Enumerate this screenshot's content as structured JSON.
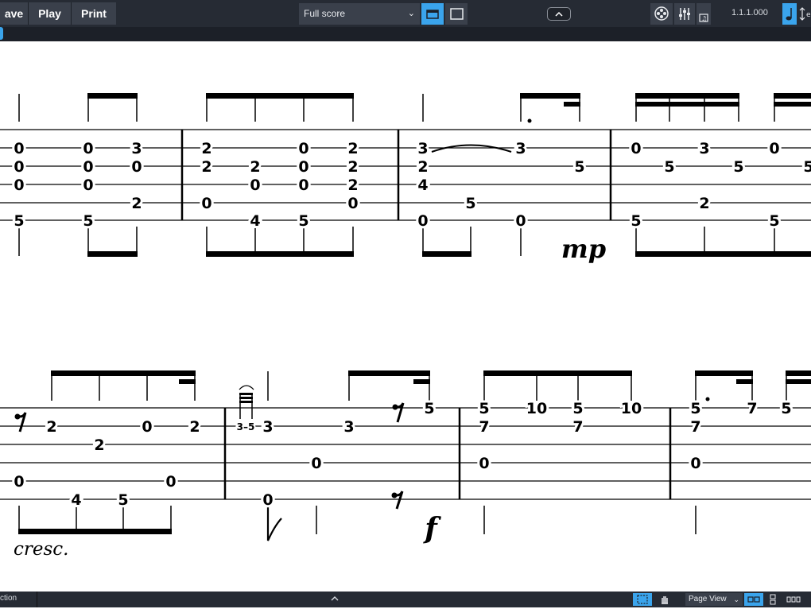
{
  "toolbar": {
    "save_label": "ave",
    "play_label": "Play",
    "print_label": "Print",
    "layout_select_value": "Full score",
    "rhythmic_position": "1.1.1.000",
    "accent_color": "#3aa4ec"
  },
  "statusbar": {
    "status_text": "ction",
    "view_select_value": "Page View"
  },
  "score": {
    "system1": {
      "fret_numbers": [
        {
          "bar": 1,
          "string": 1,
          "text": "0"
        },
        {
          "bar": 1,
          "string": 2,
          "text": "0"
        },
        {
          "bar": 1,
          "string": 3,
          "text": "0"
        },
        {
          "bar": 1,
          "string": 5,
          "text": "5"
        },
        {
          "bar": 1,
          "string": 1,
          "text": "0"
        },
        {
          "bar": 1,
          "string": 2,
          "text": "0"
        },
        {
          "bar": 1,
          "string": 3,
          "text": "0"
        },
        {
          "bar": 1,
          "string": 5,
          "text": "5"
        },
        {
          "bar": 1,
          "string": 1,
          "text": "3"
        },
        {
          "bar": 1,
          "string": 2,
          "text": "0"
        },
        {
          "bar": 1,
          "string": 4,
          "text": "2"
        },
        {
          "bar": 2,
          "string": 1,
          "text": "2"
        },
        {
          "bar": 2,
          "string": 2,
          "text": "2"
        },
        {
          "bar": 2,
          "string": 4,
          "text": "0"
        },
        {
          "bar": 2,
          "string": 2,
          "text": "2"
        },
        {
          "bar": 2,
          "string": 3,
          "text": "0"
        },
        {
          "bar": 2,
          "string": 5,
          "text": "4"
        },
        {
          "bar": 2,
          "string": 1,
          "text": "0"
        },
        {
          "bar": 2,
          "string": 2,
          "text": "0"
        },
        {
          "bar": 2,
          "string": 3,
          "text": "0"
        },
        {
          "bar": 2,
          "string": 5,
          "text": "5"
        },
        {
          "bar": 2,
          "string": 1,
          "text": "2"
        },
        {
          "bar": 2,
          "string": 2,
          "text": "2"
        },
        {
          "bar": 2,
          "string": 3,
          "text": "2"
        },
        {
          "bar": 2,
          "string": 4,
          "text": "0"
        },
        {
          "bar": 3,
          "string": 1,
          "text": "3"
        },
        {
          "bar": 3,
          "string": 2,
          "text": "2"
        },
        {
          "bar": 3,
          "string": 3,
          "text": "4"
        },
        {
          "bar": 3,
          "string": 5,
          "text": "0"
        },
        {
          "bar": 3,
          "string": 4,
          "text": "5"
        },
        {
          "bar": 3,
          "string": 1,
          "text": "3"
        },
        {
          "bar": 3,
          "string": 5,
          "text": "0"
        },
        {
          "bar": 3,
          "string": 2,
          "text": "5"
        },
        {
          "bar": 4,
          "string": 1,
          "text": "0"
        },
        {
          "bar": 4,
          "string": 5,
          "text": "5"
        },
        {
          "bar": 4,
          "string": 2,
          "text": "5"
        },
        {
          "bar": 4,
          "string": 1,
          "text": "3"
        },
        {
          "bar": 4,
          "string": 4,
          "text": "2"
        },
        {
          "bar": 4,
          "string": 2,
          "text": "5"
        },
        {
          "bar": 4,
          "string": 1,
          "text": "0"
        },
        {
          "bar": 4,
          "string": 5,
          "text": "5"
        },
        {
          "bar": 4,
          "string": 2,
          "text": "5"
        }
      ],
      "dynamic": "mp"
    },
    "system2": {
      "fret_numbers": [
        {
          "text": "2"
        },
        {
          "text": "0"
        },
        {
          "text": "2"
        },
        {
          "text": "4"
        },
        {
          "text": "5"
        },
        {
          "text": "0"
        },
        {
          "text": "2"
        },
        {
          "text": "0"
        },
        {
          "text": "3"
        },
        {
          "text": "5"
        },
        {
          "text": "3"
        },
        {
          "text": "0"
        },
        {
          "text": "3"
        },
        {
          "text": "0"
        },
        {
          "text": "5"
        },
        {
          "text": "5"
        },
        {
          "text": "7"
        },
        {
          "text": "0"
        },
        {
          "text": "10"
        },
        {
          "text": "5"
        },
        {
          "text": "7"
        },
        {
          "text": "10"
        },
        {
          "text": "5"
        },
        {
          "text": "7"
        },
        {
          "text": "0"
        },
        {
          "text": "7"
        },
        {
          "text": "5"
        }
      ],
      "grace_label": "3–5",
      "dynamic": "f",
      "text_instruction": "cresc."
    }
  }
}
